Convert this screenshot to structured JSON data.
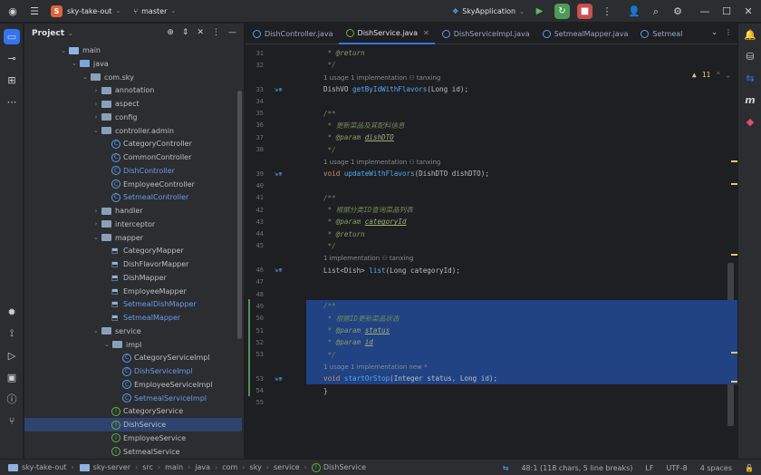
{
  "title_bar": {
    "project_badge": "S",
    "project_name": "sky-take-out",
    "branch": "master",
    "run_config": "SkyApplication"
  },
  "project_panel": {
    "title": "Project"
  },
  "tree": [
    {
      "label": "main",
      "kind": "folder",
      "depth": 3,
      "open": true
    },
    {
      "label": "java",
      "kind": "src",
      "depth": 4,
      "open": true
    },
    {
      "label": "com.sky",
      "kind": "pkg",
      "depth": 5,
      "open": true
    },
    {
      "label": "annotation",
      "kind": "pkg",
      "depth": 6,
      "open": false
    },
    {
      "label": "aspect",
      "kind": "pkg",
      "depth": 6,
      "open": false
    },
    {
      "label": "config",
      "kind": "pkg",
      "depth": 6,
      "open": false
    },
    {
      "label": "controller.admin",
      "kind": "pkg",
      "depth": 6,
      "open": true
    },
    {
      "label": "CategoryController",
      "kind": "class",
      "depth": 7
    },
    {
      "label": "CommonController",
      "kind": "class",
      "depth": 7
    },
    {
      "label": "DishController",
      "kind": "class",
      "depth": 7,
      "blue": true
    },
    {
      "label": "EmployeeController",
      "kind": "class",
      "depth": 7
    },
    {
      "label": "SetmealController",
      "kind": "class",
      "depth": 7,
      "blue": true
    },
    {
      "label": "handler",
      "kind": "pkg",
      "depth": 6,
      "open": false
    },
    {
      "label": "interceptor",
      "kind": "pkg",
      "depth": 6,
      "open": false
    },
    {
      "label": "mapper",
      "kind": "pkg",
      "depth": 6,
      "open": true
    },
    {
      "label": "CategoryMapper",
      "kind": "mapper",
      "depth": 7
    },
    {
      "label": "DishFlavorMapper",
      "kind": "mapper",
      "depth": 7
    },
    {
      "label": "DishMapper",
      "kind": "mapper",
      "depth": 7
    },
    {
      "label": "EmployeeMapper",
      "kind": "mapper",
      "depth": 7
    },
    {
      "label": "SetmealDishMapper",
      "kind": "mapper",
      "depth": 7,
      "blue": true
    },
    {
      "label": "SetmealMapper",
      "kind": "mapper",
      "depth": 7,
      "blue": true
    },
    {
      "label": "service",
      "kind": "pkg",
      "depth": 6,
      "open": true
    },
    {
      "label": "impl",
      "kind": "pkg",
      "depth": 7,
      "open": true
    },
    {
      "label": "CategoryServiceImpl",
      "kind": "class",
      "depth": 8
    },
    {
      "label": "DishServiceImpl",
      "kind": "class",
      "depth": 8,
      "blue": true
    },
    {
      "label": "EmployeeServiceImpl",
      "kind": "class",
      "depth": 8
    },
    {
      "label": "SetmealServiceImpl",
      "kind": "class",
      "depth": 8,
      "blue": true
    },
    {
      "label": "CategoryService",
      "kind": "interface",
      "depth": 7
    },
    {
      "label": "DishService",
      "kind": "interface",
      "depth": 7,
      "selected": true
    },
    {
      "label": "EmployeeService",
      "kind": "interface",
      "depth": 7
    },
    {
      "label": "SetmealService",
      "kind": "interface",
      "depth": 7
    }
  ],
  "tabs": [
    {
      "label": "DishController.java",
      "kind": "class",
      "active": false
    },
    {
      "label": "DishService.java",
      "kind": "interface",
      "active": true
    },
    {
      "label": "DishServiceImpl.java",
      "kind": "class",
      "active": false
    },
    {
      "label": "SetmealMapper.java",
      "kind": "mapper",
      "active": false
    },
    {
      "label": "Setmeal",
      "kind": "class",
      "active": false
    }
  ],
  "inspections": {
    "warnings": "11"
  },
  "code_lines": [
    {
      "n": "31",
      "html": "<span class='cm'> * </span><span class='tag'>@return</span>"
    },
    {
      "n": "32",
      "html": "<span class='cm'> */</span>"
    },
    {
      "hint": "1 usage    1 implementation    ⚇ tanxing"
    },
    {
      "n": "33",
      "gut": true,
      "html": "DishVO <span class='fn'>getByIdWithFlavors</span>(Long id);"
    },
    {
      "n": "34",
      "html": ""
    },
    {
      "n": "35",
      "html": "<span class='cm'>/**</span>"
    },
    {
      "n": "36",
      "html": "<span class='cm'> * 更新菜品及其配料信息</span>"
    },
    {
      "n": "37",
      "html": "<span class='cm'> * </span><span class='tag'>@param </span><span class='tagv'>dishDTO</span>"
    },
    {
      "n": "38",
      "html": "<span class='cm'> */</span>"
    },
    {
      "hint": "1 usage    1 implementation    ⚇ tanxing"
    },
    {
      "n": "39",
      "gut": true,
      "html": "<span class='kw'>void</span> <span class='fn'>updateWithFlavors</span>(DishDTO dishDTO);"
    },
    {
      "n": "40",
      "html": ""
    },
    {
      "n": "41",
      "html": "<span class='cm'>/**</span>"
    },
    {
      "n": "42",
      "html": "<span class='cm'> * 根据分类ID查询菜品列表</span>"
    },
    {
      "n": "43",
      "html": "<span class='cm'> * </span><span class='tag'>@param </span><span class='tagv'>categoryId</span>"
    },
    {
      "n": "44",
      "html": "<span class='cm'> * </span><span class='tag'>@return</span>"
    },
    {
      "n": "45",
      "html": "<span class='cm'> */</span>"
    },
    {
      "hint": "1 implementation    ⚇ tanxing"
    },
    {
      "n": "46",
      "gut": true,
      "html": "List&lt;Dish&gt; <span class='fn'>list</span>(Long categoryId);"
    },
    {
      "n": "47",
      "html": ""
    },
    {
      "n": "48",
      "html": ""
    },
    {
      "n": "49",
      "html": "<span class='cm'>/**</span>"
    },
    {
      "n": "50",
      "html": "<span class='cm'> * 根据ID更新菜品状态</span>"
    },
    {
      "n": "51",
      "html": "<span class='cm'> * </span><span class='tag'>@param </span><span class='tagv'>status</span>"
    },
    {
      "n": "52",
      "html": "<span class='cm'> * </span><span class='tag'>@param </span><span class='tagv'>id</span>"
    },
    {
      "n": "53",
      "html": "<span class='cm'> */</span>"
    },
    {
      "hint": "1 usage    1 implementation    new *"
    },
    {
      "n": "53",
      "gut": true,
      "html": "<span class='kw'>void</span> <span class='fn'>startOrStop</span>(Integer status, Long id);"
    },
    {
      "n": "54",
      "html": "}"
    },
    {
      "n": "55",
      "html": ""
    }
  ],
  "breadcrumb": [
    "sky-take-out",
    "sky-server",
    "src",
    "main",
    "java",
    "com",
    "sky",
    "service",
    "DishService"
  ],
  "status": {
    "position": "48:1 (118 chars, 5 line breaks)",
    "line_sep": "LF",
    "encoding": "UTF-8",
    "indent": "4 spaces"
  }
}
